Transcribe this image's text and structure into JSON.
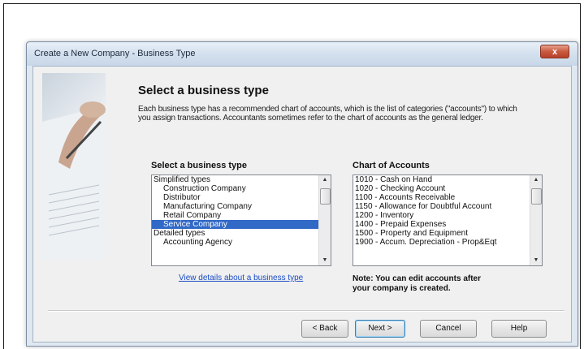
{
  "dialog": {
    "title": "Create a New Company - Business Type",
    "close_label": "x"
  },
  "heading": "Select a business type",
  "description": "Each business type has a recommended chart of accounts, which is the list of categories (\"accounts\") to which you assign transactions. Accountants sometimes refer to the chart of accounts as the general ledger.",
  "business_list": {
    "label": "Select a business type",
    "items": [
      {
        "text": "Simplified types",
        "indent": false,
        "selected": false
      },
      {
        "text": "Construction Company",
        "indent": true,
        "selected": false
      },
      {
        "text": "Distributor",
        "indent": true,
        "selected": false
      },
      {
        "text": "Manufacturing Company",
        "indent": true,
        "selected": false
      },
      {
        "text": "Retail Company",
        "indent": true,
        "selected": false
      },
      {
        "text": "Service Company",
        "indent": true,
        "selected": true
      },
      {
        "text": "Detailed types",
        "indent": false,
        "selected": false
      },
      {
        "text": "Accounting Agency",
        "indent": true,
        "selected": false
      }
    ]
  },
  "accounts_list": {
    "label": "Chart of Accounts",
    "items": [
      "1010 - Cash on Hand",
      "1020 - Checking Account",
      "1100 - Accounts Receivable",
      "1150 - Allowance for Doubtful Account",
      "1200 - Inventory",
      "1400 - Prepaid Expenses",
      "1500 - Property and Equipment",
      "1900 - Accum. Depreciation - Prop&Eqt"
    ]
  },
  "details_link": "View details about a business type",
  "note_line1": "Note: You can edit accounts after",
  "note_line2": "your company is created.",
  "buttons": {
    "back": "< Back",
    "next": "Next >",
    "cancel": "Cancel",
    "help": "Help"
  },
  "colors": {
    "selection": "#3169c6",
    "link": "#1a4cc7",
    "close_button": "#c85a3f"
  }
}
